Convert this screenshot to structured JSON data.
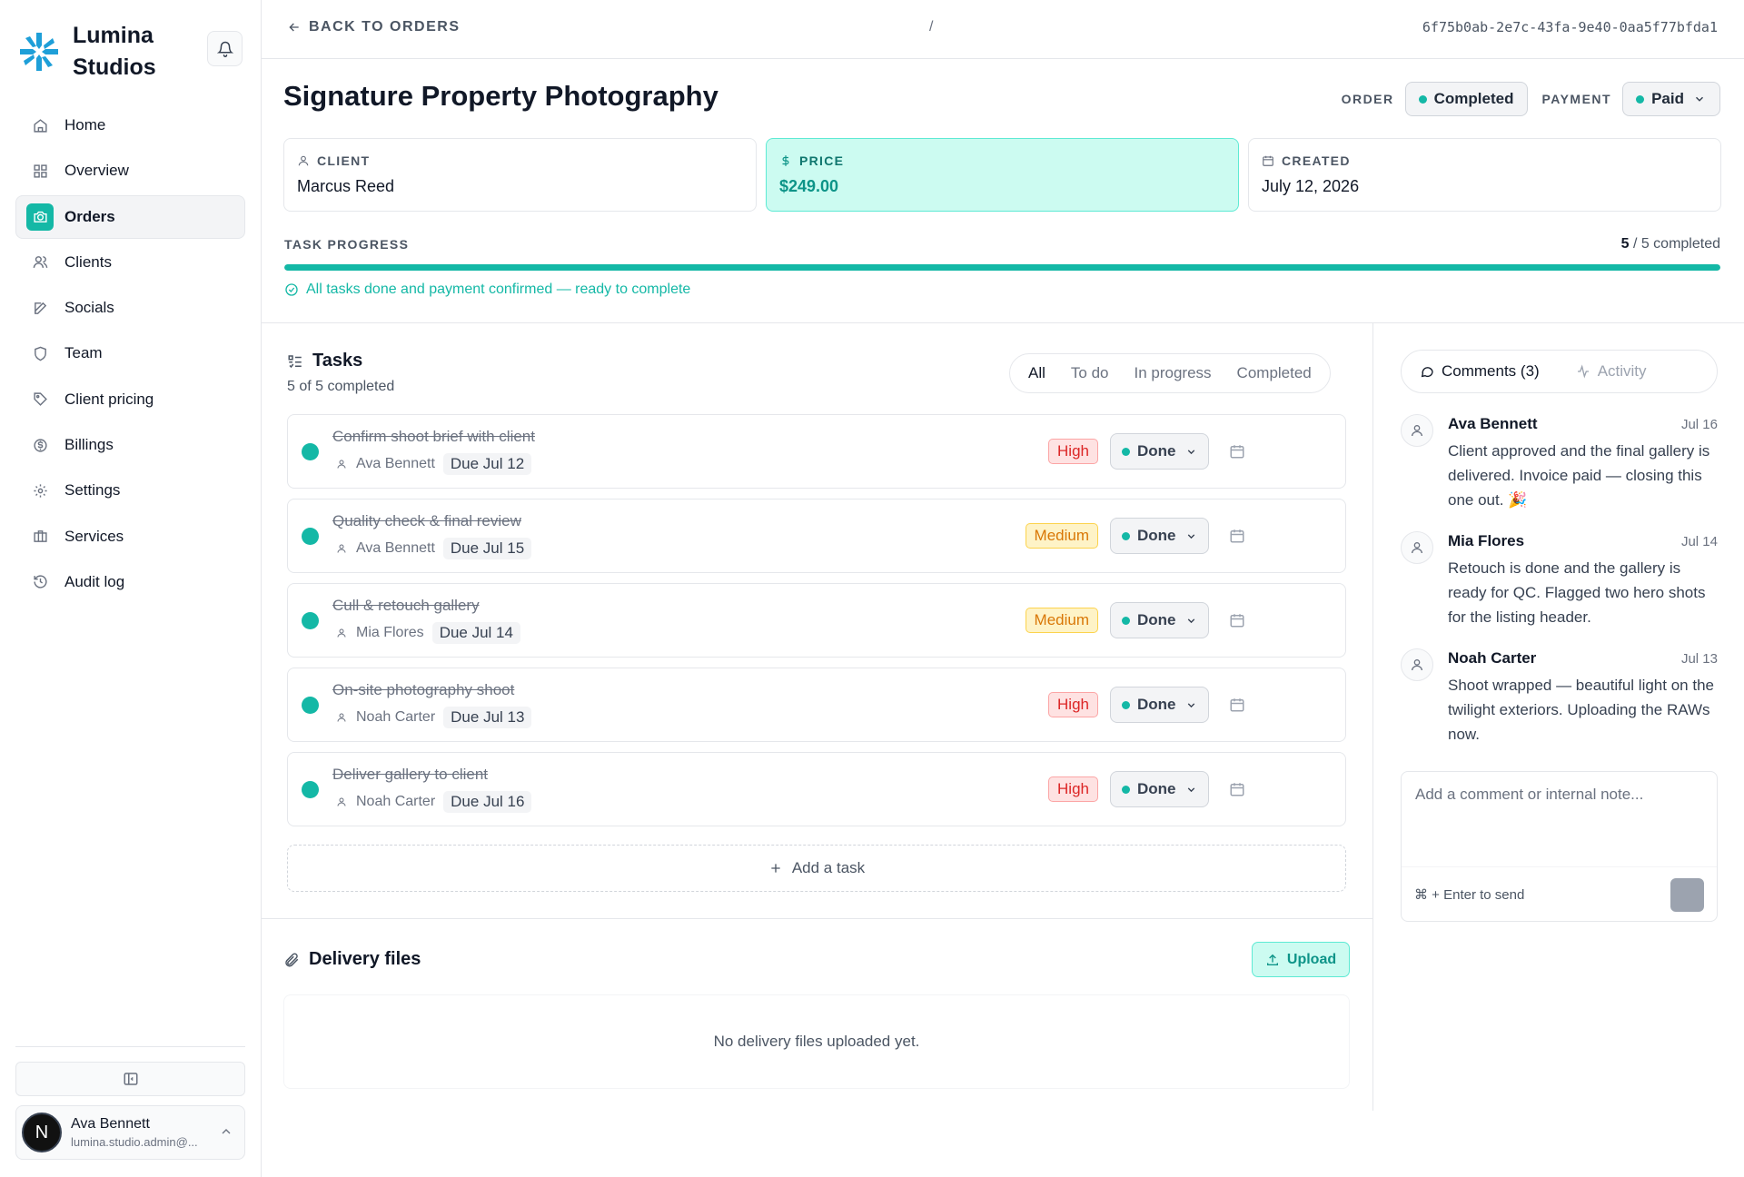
{
  "app": {
    "brand_name": "Lumina Studios"
  },
  "nav": {
    "items": [
      {
        "label": "Home",
        "icon": "home-icon"
      },
      {
        "label": "Overview",
        "icon": "grid-icon"
      },
      {
        "label": "Orders",
        "icon": "camera-icon",
        "active": true
      },
      {
        "label": "Clients",
        "icon": "users-icon"
      },
      {
        "label": "Socials",
        "icon": "edit-icon"
      },
      {
        "label": "Team",
        "icon": "shield-icon"
      },
      {
        "label": "Client pricing",
        "icon": "tag-icon"
      },
      {
        "label": "Billings",
        "icon": "dollar-circle-icon"
      },
      {
        "label": "Settings",
        "icon": "gear-icon"
      },
      {
        "label": "Services",
        "icon": "box-icon"
      },
      {
        "label": "Audit log",
        "icon": "history-icon"
      }
    ]
  },
  "user": {
    "initial": "N",
    "name": "Ava Bennett",
    "email": "lumina.studio.admin@..."
  },
  "topbar": {
    "back_label": "BACK TO ORDERS",
    "separator": "/",
    "order_id": "6f75b0ab-2e7c-43fa-9e40-0aa5f77bfda1"
  },
  "order": {
    "title": "Signature Property Photography",
    "order_label": "ORDER",
    "order_status": "Completed",
    "payment_label": "PAYMENT",
    "payment_status": "Paid",
    "accent_color": "#14b8a6"
  },
  "info": {
    "client_label": "CLIENT",
    "client_value": "Marcus Reed",
    "price_label": "PRICE",
    "price_value": "$249.00",
    "created_label": "CREATED",
    "created_value": "July 12, 2026"
  },
  "progress": {
    "label": "TASK PROGRESS",
    "done": "5",
    "total_text": " / 5 completed",
    "fraction": 1.0,
    "message": "All tasks done and payment confirmed — ready to complete"
  },
  "tasks": {
    "title": "Tasks",
    "subtitle": "5 of 5 completed",
    "filters": [
      "All",
      "To do",
      "In progress",
      "Completed"
    ],
    "active_filter": "All",
    "items": [
      {
        "title": "Confirm shoot brief with client",
        "assignee": "Ava Bennett",
        "due": "Due Jul 12",
        "priority": "High",
        "status": "Done"
      },
      {
        "title": "Quality check & final review",
        "assignee": "Ava Bennett",
        "due": "Due Jul 15",
        "priority": "Medium",
        "status": "Done"
      },
      {
        "title": "Cull & retouch gallery",
        "assignee": "Mia Flores",
        "due": "Due Jul 14",
        "priority": "Medium",
        "status": "Done"
      },
      {
        "title": "On-site photography shoot",
        "assignee": "Noah Carter",
        "due": "Due Jul 13",
        "priority": "High",
        "status": "Done"
      },
      {
        "title": "Deliver gallery to client",
        "assignee": "Noah Carter",
        "due": "Due Jul 16",
        "priority": "High",
        "status": "Done"
      }
    ],
    "add_label": "Add a task"
  },
  "delivery": {
    "title": "Delivery files",
    "upload_label": "Upload",
    "empty_text": "No delivery files uploaded yet."
  },
  "comments": {
    "tab_comments": "Comments (3)",
    "tab_activity": "Activity",
    "items": [
      {
        "author": "Ava Bennett",
        "date": "Jul 16",
        "text": "Client approved and the final gallery is delivered. Invoice paid — closing this one out. 🎉"
      },
      {
        "author": "Mia Flores",
        "date": "Jul 14",
        "text": "Retouch is done and the gallery is ready for QC. Flagged two hero shots for the listing header."
      },
      {
        "author": "Noah Carter",
        "date": "Jul 13",
        "text": "Shoot wrapped — beautiful light on the twilight exteriors. Uploading the RAWs now."
      }
    ],
    "placeholder": "Add a comment or internal note...",
    "hint": "⌘ + Enter to send"
  }
}
